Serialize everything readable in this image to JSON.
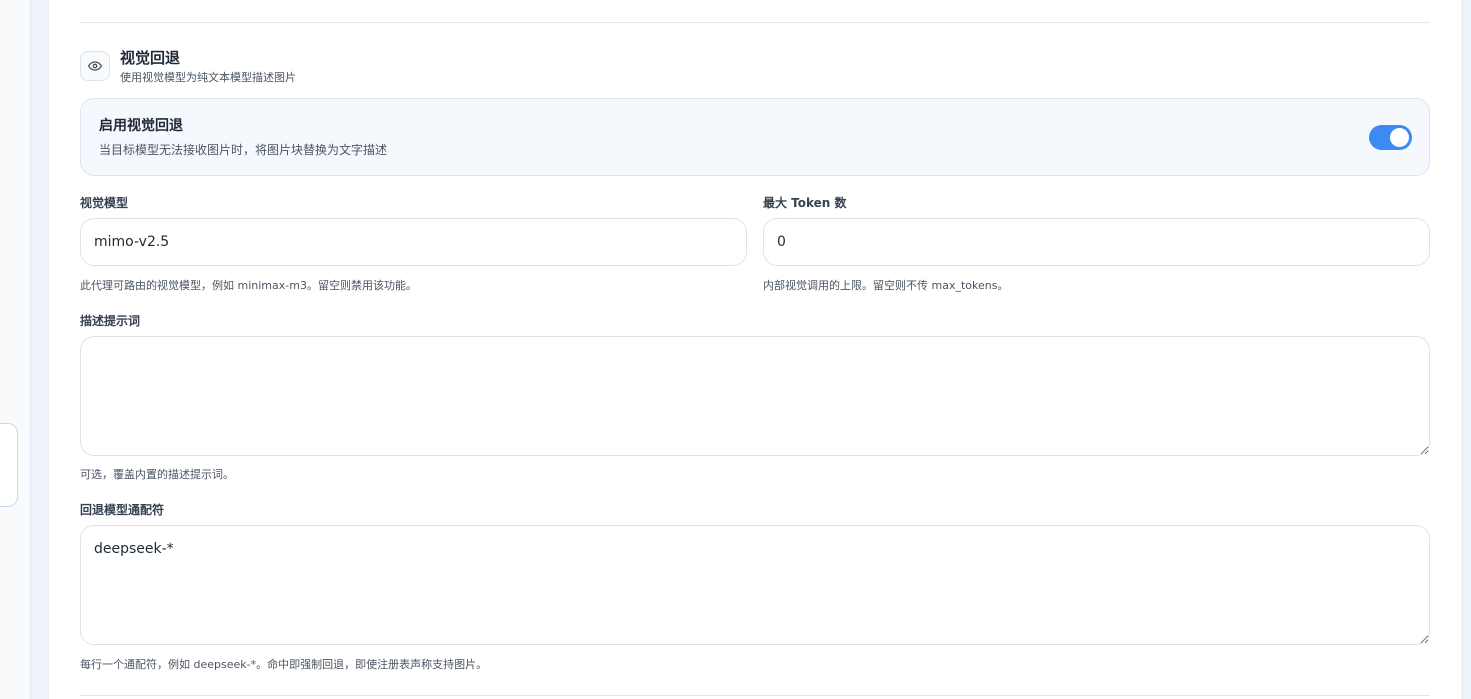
{
  "section": {
    "icon": "eye-icon",
    "title": "视觉回退",
    "subtitle": "使用视觉模型为纯文本模型描述图片"
  },
  "enable": {
    "title": "启用视觉回退",
    "description": "当目标模型无法接收图片时，将图片块替换为文字描述",
    "enabled": true,
    "accent": "#3b8bf2"
  },
  "vision_model": {
    "label": "视觉模型",
    "value": "mimo-v2.5",
    "help": "此代理可路由的视觉模型，例如 minimax-m3。留空则禁用该功能。"
  },
  "max_tokens": {
    "label": "最大 Token 数",
    "value": "0",
    "help": "内部视觉调用的上限。留空则不传 max_tokens。"
  },
  "prompt": {
    "label": "描述提示词",
    "value": "",
    "help": "可选，覆盖内置的描述提示词。"
  },
  "wildcards": {
    "label": "回退模型通配符",
    "value": "deepseek-*",
    "help": "每行一个通配符，例如 deepseek-*。命中即强制回退，即使注册表声称支持图片。"
  }
}
